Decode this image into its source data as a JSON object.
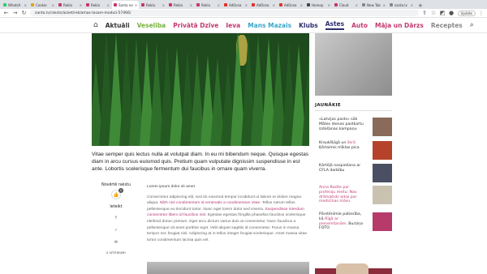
{
  "browser": {
    "tabs": [
      {
        "label": "WhatsA",
        "color": "#25d366"
      },
      {
        "label": "Cookie",
        "color": "#e0a020"
      },
      {
        "label": "Rekla",
        "color": "#c2386e"
      },
      {
        "label": "Rekla",
        "color": "#c2386e"
      },
      {
        "label": "Santa ne",
        "color": "#c2386e"
      },
      {
        "label": "Rekla",
        "color": "#c2386e"
      },
      {
        "label": "Rekla",
        "color": "#c2386e"
      },
      {
        "label": "Rekla",
        "color": "#c2386e"
      },
      {
        "label": "AdOcea",
        "color": "#e0312b"
      },
      {
        "label": "AdOcea",
        "color": "#e0312b"
      },
      {
        "label": "AdOcea",
        "color": "#e0312b"
      },
      {
        "label": "Homep",
        "color": "#444444"
      },
      {
        "label": "Cloud",
        "color": "#c2386e"
      },
      {
        "label": "New Tab",
        "color": "#888888"
      },
      {
        "label": "santa.lv",
        "color": "#888888"
      }
    ],
    "active_tab_index": 4,
    "url": "santa.lv/raksts/aiziet/reklamas-lasam-moduli-57466/",
    "update_label": "Update"
  },
  "nav": {
    "items": [
      {
        "label": "Aktuāli",
        "color": "#333333"
      },
      {
        "label": "Veselība",
        "color": "#7ab03f"
      },
      {
        "label": "Privātā Dzīve",
        "color": "#c2386e"
      },
      {
        "label": "Ieva",
        "color": "#c2386e"
      },
      {
        "label": "Mans Mazais",
        "color": "#3aa6c9"
      },
      {
        "label": "Klubs",
        "color": "#2d2e6d"
      },
      {
        "label": "Astes",
        "color": "#2d2e6d"
      },
      {
        "label": "Auto",
        "color": "#c2386e"
      },
      {
        "label": "Māja un Dārzs",
        "color": "#c2386e"
      },
      {
        "label": "Receptes",
        "color": "#888888"
      }
    ],
    "active_index": 6
  },
  "article": {
    "lead": "Vitae semper quis lectus nulla at volutpat diam. In eu mi bibendum neque. Quisque egestas diam in arcu cursus euismod quis. Pretium quam vulputate dignissim suspendisse in est ante. Lobortis scelerisque fermentum dui faucibus in ornare quam viverra.",
    "subtitle": "Lorem ipsum dolor sit amet",
    "body_parts": [
      {
        "text": "Consectetur adipiscing elit, sed do eiusmod tempor incididunt ut labore et dolore magna aliqua. ",
        "link": false
      },
      {
        "text": "Nibh nisl condimentum id venenatis a condimentum vitae.",
        "link": true
      },
      {
        "text": " Tellus rutrum tellus pellentesque eu tincidunt tortor. Nunc eget lorem dolor sed viverra. ",
        "link": false
      },
      {
        "text": "Suspendisse interdum consectetur libero id faucibus nisl.",
        "link": true
      },
      {
        "text": " Egestas egestas fringilla phasellus faucibus scelerisque eleifend donec pretium. Eget arcu dictum varius duis at consectetur. Nunc faucibus a pellentesque sit amet porttitor eget. Velit aliquet sagittis id consectetur. Purus in massa tempor nec feugiat nisl. Adipiscing at in tellus integer feugiat scelerisque. Amet massa vitae tortor condimentum lacinia quis vel.",
        "link": false
      }
    ]
  },
  "share": {
    "title": "Novērtē rakstu",
    "like_count": "0",
    "share_label": "Ieteikt",
    "icons": [
      "f",
      "fb-share",
      "mail"
    ],
    "comments": "0 IZTEIKUMI"
  },
  "sidebar": {
    "title": "JAUNĀKIE",
    "items": [
      {
        "parts": [
          {
            "t": "«Latvijas pasts» sāk Mātes dienas pastkartu izdošanas kampaņu",
            "pink": false
          }
        ],
        "thumb": "#8a6a5a"
      },
      {
        "parts": [
          {
            "t": "Kraukšķīgā un ",
            "pink": false
          },
          {
            "t": "likrā",
            "pink": true
          },
          {
            "t": " Ķērlaimis mīklas pica",
            "pink": false
          }
        ],
        "thumb": "#b5422a"
      },
      {
        "parts": [
          {
            "t": "Kārtējā nospiešana ar CFLA darbību",
            "pink": false
          }
        ],
        "thumb": "#4a4f63"
      },
      {
        "parts": [
          {
            "t": "Anna Rozīte par ",
            "pink": true
          },
          {
            "t": "profesiju mešu: Nav drāmatiski aikai par medicīnas māsu",
            "pink": true
          }
        ],
        "thumb": "#c9c2b0"
      },
      {
        "parts": [
          {
            "t": "Pārstēnīmie patiesība, kā ",
            "pink": false
          },
          {
            "t": "Rīgā ar pieņemšanām",
            "pink": true
          },
          {
            "t": ". Burziņa FOTO",
            "pink": false
          }
        ],
        "thumb": "#b63a6a"
      }
    ]
  }
}
